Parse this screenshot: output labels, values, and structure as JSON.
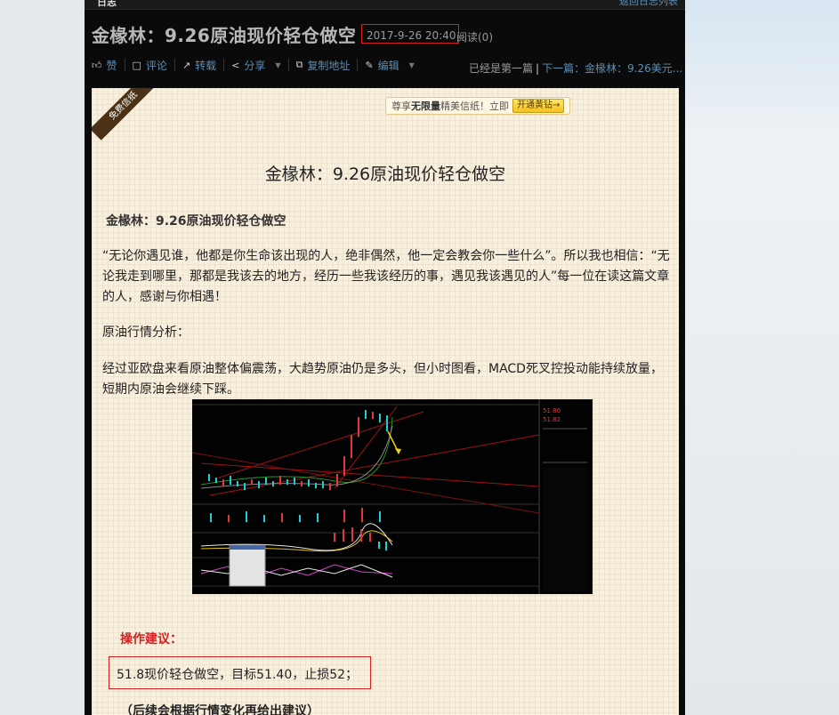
{
  "topbar": {
    "left_text": "日志",
    "right_link": "返回日志列表"
  },
  "post": {
    "title": "金椽林：9.26原油现价轻仓做空",
    "date": "2017-9-26 20:40",
    "reads": "阅读(0)"
  },
  "toolbar": {
    "like": "赞",
    "comment": "评论",
    "repost": "转载",
    "share": "分享",
    "copy": "复制地址",
    "edit": "编辑"
  },
  "nav": {
    "first": "已经是第一篇",
    "next_label": "下一篇：",
    "next_title": "金椽林：9.26美元..."
  },
  "paper": {
    "ribbon": "免费信纸",
    "promo_prefix": "尊享",
    "promo_bold": "无限量",
    "promo_suffix": "精美信纸！立即",
    "promo_button": "开通黄钻→"
  },
  "article": {
    "heading": "金椽林：9.26原油现价轻仓做空",
    "subheading": "金椽林：9.26原油现价轻仓做空",
    "quote_line1": "“无论你遇见谁，他都是你生命该出现的人，绝非偶然，他一定会教会你一些什么”。所以我也相信：“无",
    "quote_line2": "论我走到哪里，那都是我该去的地方，经历一些我该经历的事，遇见我该遇见的人”每一位在读这篇文章",
    "quote_line3": "的人，感谢与你相遇！",
    "analysis_label": "原油行情分析：",
    "analysis_line1": "经过亚欧盘来看原油整体偏震荡，大趋势原油仍是多头，但小时图看，MACD死叉控投动能持续放量，",
    "analysis_line2": "短期内原油会继续下踩。",
    "advice_label": "操作建议：",
    "advice_text": "51.8现价轻仓做空，目标51.40，止损52；",
    "follow_text": "（后续会根据行情变化再给出建议）"
  },
  "chart_image": {
    "quote": [
      "51.80",
      "51.82"
    ],
    "colors": {
      "bg": "#020202",
      "up": "#19d0d6",
      "down": "#e23a3a",
      "trend": "#b01818",
      "arrow": "#f2d21a"
    }
  }
}
